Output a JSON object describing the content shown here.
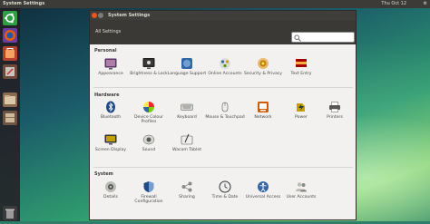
{
  "panel": {
    "title": "System Settings",
    "clock": "Thu Oct 12"
  },
  "window": {
    "title": "System Settings",
    "all_settings": "All Settings"
  },
  "sections": {
    "personal": {
      "title": "Personal",
      "items": [
        {
          "label": "Appearance",
          "icon": "appearance-icon"
        },
        {
          "label": "Brightness & Lock",
          "icon": "brightness-icon"
        },
        {
          "label": "Language Support",
          "icon": "language-icon"
        },
        {
          "label": "Online Accounts",
          "icon": "online-accounts-icon"
        },
        {
          "label": "Security & Privacy",
          "icon": "security-icon"
        },
        {
          "label": "Text Entry",
          "icon": "keyboard-flag-icon"
        }
      ]
    },
    "hardware": {
      "title": "Hardware",
      "items": [
        {
          "label": "Bluetooth",
          "icon": "bluetooth-icon"
        },
        {
          "label": "Device Colour Profiles",
          "icon": "color-icon"
        },
        {
          "label": "Keyboard",
          "icon": "keyboard-icon"
        },
        {
          "label": "Mouse & Touchpad",
          "icon": "mouse-icon"
        },
        {
          "label": "Network",
          "icon": "network-icon"
        },
        {
          "label": "Power",
          "icon": "power-icon"
        },
        {
          "label": "Printers",
          "icon": "printer-icon"
        },
        {
          "label": "Screen Display",
          "icon": "display-icon"
        },
        {
          "label": "Sound",
          "icon": "sound-icon"
        },
        {
          "label": "Wacom Tablet",
          "icon": "tablet-icon"
        }
      ]
    },
    "system": {
      "title": "System",
      "items": [
        {
          "label": "Details",
          "icon": "details-icon"
        },
        {
          "label": "Firewall Configuration",
          "icon": "firewall-icon"
        },
        {
          "label": "Sharing",
          "icon": "sharing-icon"
        },
        {
          "label": "Time & Date",
          "icon": "clock-icon"
        },
        {
          "label": "Universal Access",
          "icon": "accessibility-icon"
        },
        {
          "label": "User Accounts",
          "icon": "users-icon"
        }
      ]
    }
  },
  "colors": {
    "panel": "#3c3b37",
    "window_bg": "#f2f1f0",
    "accent": "#e95420"
  }
}
